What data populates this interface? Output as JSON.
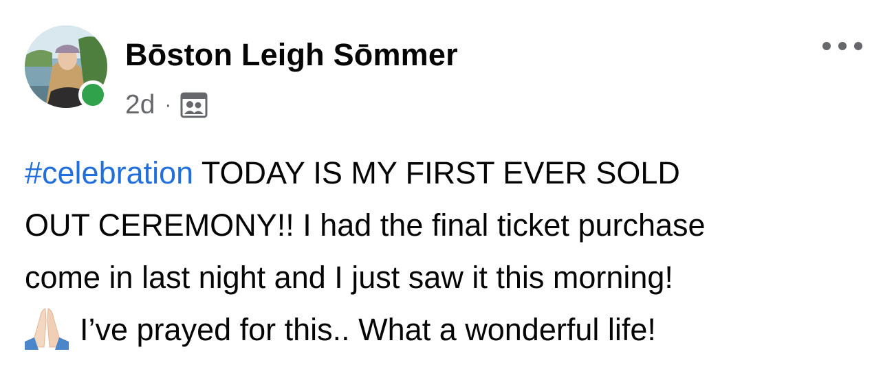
{
  "post": {
    "author": {
      "name": "Bōston Leigh Sōmmer",
      "online": true
    },
    "meta": {
      "timestamp": "2d",
      "separator": "·",
      "audience_icon": "group-audience-icon"
    },
    "menu_icon": "more-options-icon",
    "hashtag": "#celebration",
    "text_lines": {
      "line1_rest": " TODAY IS MY FIRST EVER SOLD",
      "line2": "OUT CEREMONY!! I had the final ticket purchase",
      "line3": "come in last night and I just saw it this morning!",
      "line4_rest": "I’ve prayed for this.. What a wonderful life!"
    },
    "emoji": "folded-hands-icon"
  },
  "colors": {
    "text": "#050505",
    "secondary_text": "#65676b",
    "hashtag": "#216fdb",
    "online": "#31a24c"
  }
}
